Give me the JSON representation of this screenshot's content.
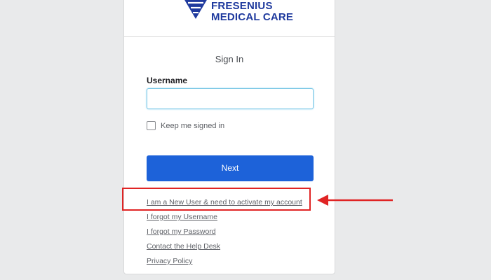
{
  "brand": {
    "line1": "FRESENIUS",
    "line2": "MEDICAL CARE",
    "logo_icon": "fresenius-shield-icon",
    "color": "#1f3a9e"
  },
  "form": {
    "title": "Sign In",
    "username_label": "Username",
    "username_value": "",
    "username_placeholder": "",
    "keep_signed_in_label": "Keep me signed in",
    "keep_signed_in_checked": false,
    "next_button": "Next",
    "accent_color": "#1d62d9"
  },
  "links": {
    "new_user": "I am a New User & need to activate my account",
    "forgot_username": "I forgot my Username",
    "forgot_password": "I forgot my Password",
    "help_desk": "Contact the Help Desk",
    "privacy": "Privacy Policy"
  },
  "annotation": {
    "highlight_color": "#e02424",
    "arrow_icon": "left-arrow-icon"
  }
}
